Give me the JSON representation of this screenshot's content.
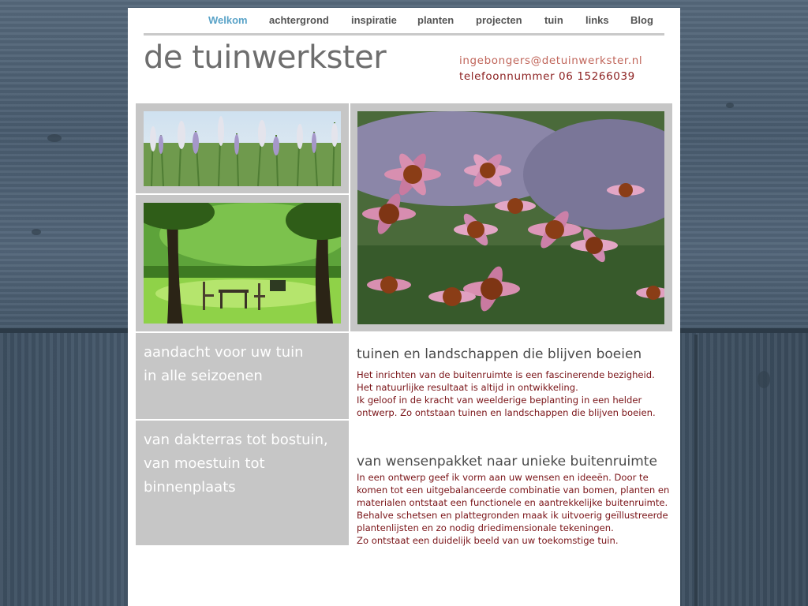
{
  "nav": {
    "items": [
      {
        "label": "Welkom",
        "active": true
      },
      {
        "label": "achtergrond"
      },
      {
        "label": "inspiratie"
      },
      {
        "label": "planten"
      },
      {
        "label": "projecten"
      },
      {
        "label": "tuin"
      },
      {
        "label": "links"
      },
      {
        "label": "Blog"
      }
    ]
  },
  "header": {
    "title": "de tuinwerkster",
    "email": "ingebongers@detuinwerkster.nl",
    "phone": "telefoonnummer 06 15266039"
  },
  "slogans": {
    "first": [
      "aandacht voor uw tuin",
      "in alle seizoenen"
    ],
    "second": [
      "van dakterras tot bostuin,",
      "van moestuin tot",
      "binnenplaats"
    ]
  },
  "sections": [
    {
      "heading": "tuinen en landschappen die blijven boeien",
      "lines": [
        "Het inrichten van de buitenruimte is een fascinerende bezigheid.",
        "Het natuurlijke resultaat is altijd in ontwikkeling.",
        "Ik geloof in de kracht van weelderige beplanting in een helder",
        "ontwerp. Zo ontstaan tuinen en landschappen die blijven boeien."
      ]
    },
    {
      "heading": "van wensenpakket naar unieke buitenruimte",
      "lines": [
        "In een ontwerp geef ik vorm aan uw wensen en ideeën. Door te",
        "komen tot een uitgebalanceerde combinatie van bomen, planten en",
        "materialen ontstaat een functionele en aantrekkelijke buitenruimte.",
        "Behalve schetsen en plattegronden maak ik uitvoerig geïllustreerde",
        "plantenlijsten en zo nodig driedimensionale tekeningen.",
        "Zo ontstaat een duidelijk beeld van uw toekomstige tuin."
      ]
    }
  ],
  "colors": {
    "nav_active": "#5aa3c8",
    "nav_text": "#555555",
    "body_text": "#7a1418",
    "email": "#c0655a",
    "phone": "#8b1e1e",
    "panel_grey": "#c6c6c6"
  }
}
